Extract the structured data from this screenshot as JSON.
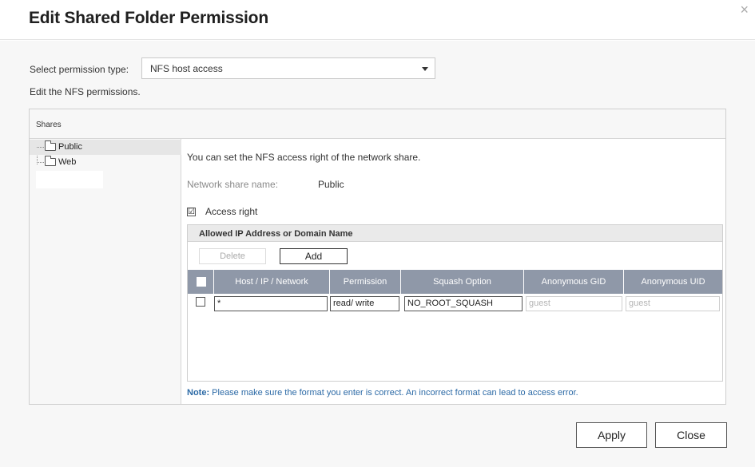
{
  "dialog": {
    "title": "Edit Shared Folder Permission",
    "close_glyph": "×"
  },
  "permission": {
    "label": "Select permission type:",
    "selected": "NFS host access",
    "description": "Edit the NFS permissions."
  },
  "shares": {
    "header": "Shares",
    "tree": [
      {
        "label": "Public",
        "selected": true
      },
      {
        "label": "Web",
        "selected": false
      }
    ]
  },
  "content": {
    "intro": "You can set the NFS access right of the network share.",
    "network_share_label": "Network share name:",
    "network_share_value": "Public",
    "access_right_label": "Access right",
    "access_right_checked": "☑"
  },
  "ip_section": {
    "title": "Allowed IP Address or Domain Name",
    "delete_label": "Delete",
    "add_label": "Add",
    "columns": [
      "Host / IP / Network",
      "Permission",
      "Squash Option",
      "Anonymous GID",
      "Anonymous UID"
    ],
    "rows": [
      {
        "host": "*",
        "permission": "read/ write",
        "squash": "NO_ROOT_SQUASH",
        "gid": "guest",
        "uid": "guest"
      }
    ]
  },
  "note": {
    "prefix": "Note:",
    "text": " Please make sure the format you enter is correct. An incorrect format can lead to access error."
  },
  "footer": {
    "apply_label": "Apply",
    "close_label": "Close"
  },
  "colors": {
    "table_header": "#8f98a8",
    "note_text": "#2c6aa6"
  }
}
